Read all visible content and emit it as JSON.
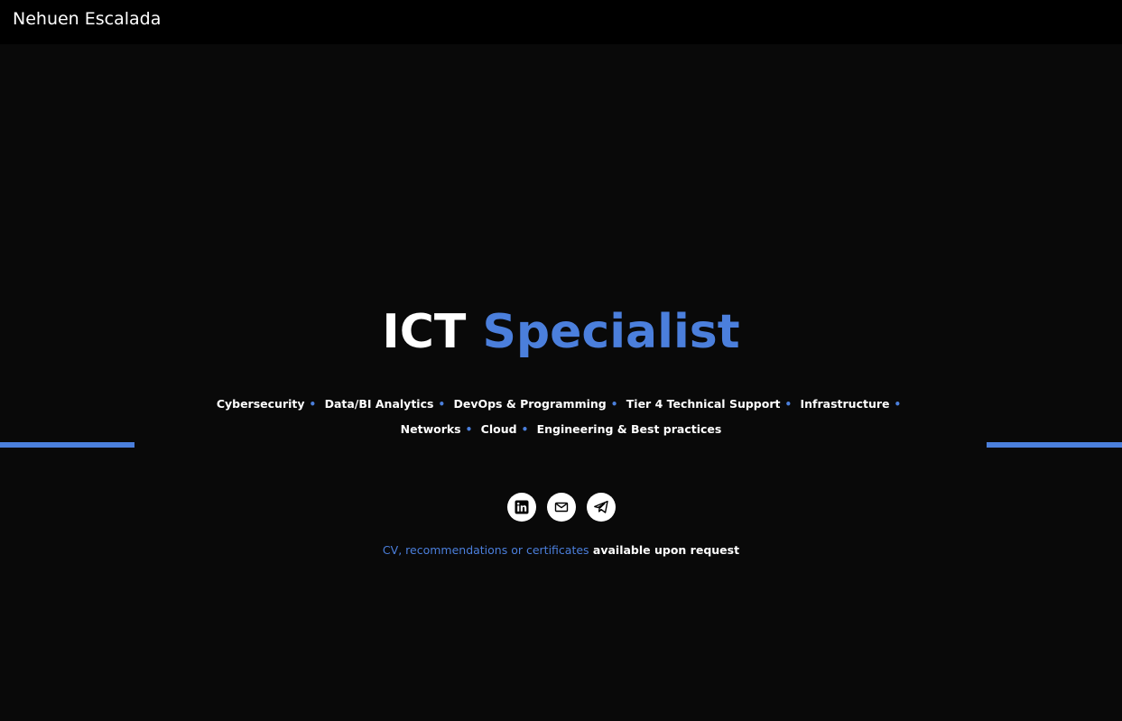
{
  "header": {
    "brand": "Nehuen Escalada"
  },
  "hero": {
    "title_part1": "ICT",
    "title_part2": "Specialist"
  },
  "skills": [
    "Cybersecurity",
    "Data/BI Analytics",
    "DevOps & Programming",
    "Tier 4 Technical Support",
    "Infrastructure",
    "Networks",
    "Cloud",
    "Engineering & Best practices"
  ],
  "separator": "•",
  "social": [
    {
      "icon": "linkedin-icon"
    },
    {
      "icon": "mail-icon"
    },
    {
      "icon": "telegram-icon"
    }
  ],
  "note": {
    "link_text": "CV, recommendations or certificates",
    "rest_text": " available upon request"
  },
  "colors": {
    "accent": "#4b7fdc",
    "background": "#090909",
    "header_background": "#000000",
    "text": "#ffffff"
  }
}
